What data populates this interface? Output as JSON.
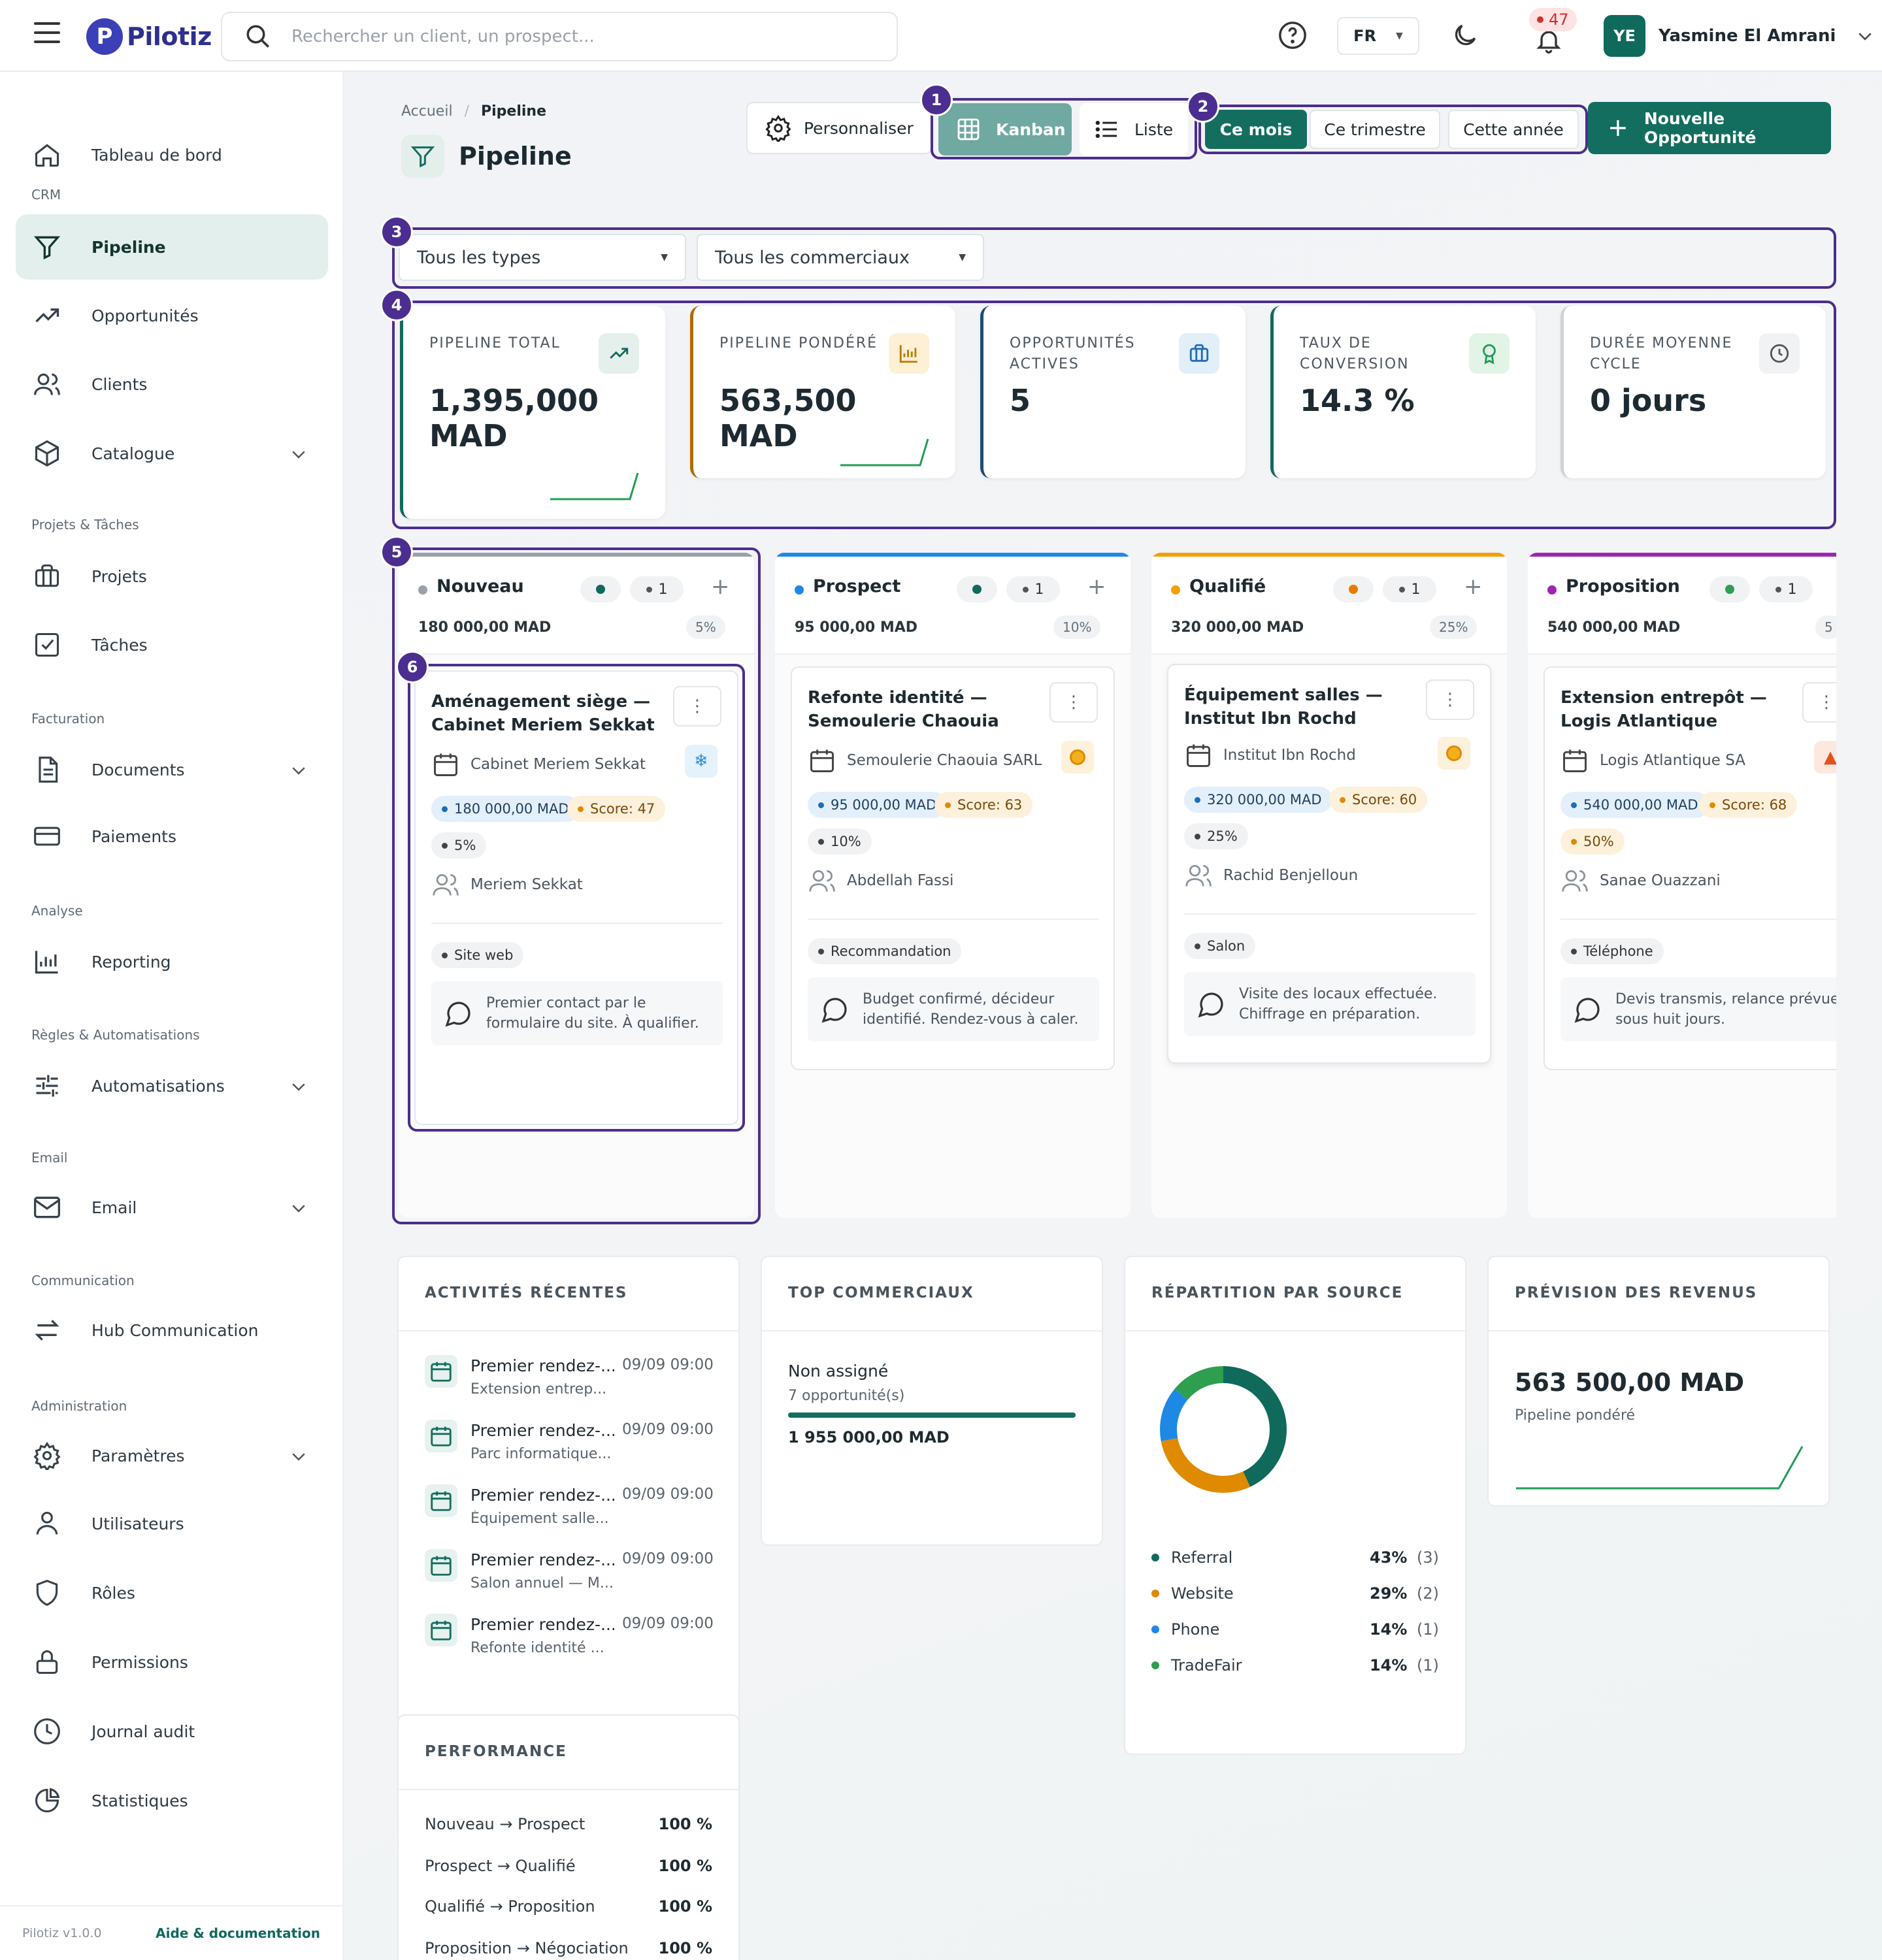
{
  "app": {
    "logo_letter": "P",
    "name": "Pilotiz"
  },
  "search": {
    "placeholder": "Rechercher un client, un prospect..."
  },
  "header": {
    "language": "FR",
    "notifications_count": "47",
    "user": {
      "initials": "YE",
      "name": "Yasmine El Amrani"
    }
  },
  "sidebar": {
    "items": [
      {
        "label": "Tableau de bord",
        "icon": "home-icon"
      },
      {
        "section": "CRM"
      },
      {
        "label": "Pipeline",
        "icon": "filter-icon",
        "active": true
      },
      {
        "label": "Opportunités",
        "icon": "trending-up-icon"
      },
      {
        "label": "Clients",
        "icon": "users-icon"
      },
      {
        "label": "Catalogue",
        "icon": "box-icon",
        "expandable": true
      },
      {
        "section": "Projets & Tâches"
      },
      {
        "label": "Projets",
        "icon": "briefcase-icon"
      },
      {
        "label": "Tâches",
        "icon": "checkbox-icon"
      },
      {
        "section": "Facturation"
      },
      {
        "label": "Documents",
        "icon": "document-icon",
        "expandable": true
      },
      {
        "label": "Paiements",
        "icon": "credit-card-icon"
      },
      {
        "section": "Analyse"
      },
      {
        "label": "Reporting",
        "icon": "bar-chart-icon"
      },
      {
        "section": "Règles & Automatisations"
      },
      {
        "label": "Automatisations",
        "icon": "sliders-icon",
        "expandable": true
      },
      {
        "section": "Email"
      },
      {
        "label": "Email",
        "icon": "mail-icon",
        "expandable": true
      },
      {
        "section": "Communication"
      },
      {
        "label": "Hub Communication",
        "icon": "arrows-icon"
      },
      {
        "section": "Administration"
      },
      {
        "label": "Paramètres",
        "icon": "gear-icon",
        "expandable": true
      },
      {
        "label": "Utilisateurs",
        "icon": "user-icon"
      },
      {
        "label": "Rôles",
        "icon": "shield-icon"
      },
      {
        "label": "Permissions",
        "icon": "lock-icon"
      },
      {
        "label": "Journal audit",
        "icon": "clock-icon"
      },
      {
        "label": "Statistiques",
        "icon": "pie-chart-icon"
      }
    ],
    "footer": {
      "version": "Pilotiz v1.0.0",
      "help": "Aide & documentation"
    }
  },
  "breadcrumb": {
    "home": "Accueil",
    "separator": "/",
    "current": "Pipeline"
  },
  "page": {
    "title": "Pipeline"
  },
  "toolbar": {
    "customize": "Personnaliser",
    "view_kanban": "Kanban",
    "view_list": "Liste",
    "period_month": "Ce mois",
    "period_quarter": "Ce trimestre",
    "period_year": "Cette année",
    "new_opportunity": "Nouvelle Opportunité"
  },
  "highlights": [
    "1",
    "2",
    "3",
    "4",
    "5",
    "6"
  ],
  "filters": {
    "types": "Tous les types",
    "sales": "Tous les commerciaux"
  },
  "kpis": [
    {
      "label": "PIPELINE TOTAL",
      "value": "1,395,000 MAD",
      "color": "#0f6a5c",
      "icon": "trend-up-icon"
    },
    {
      "label": "PIPELINE PONDÉRÉ",
      "value": "563,500 MAD",
      "color": "#b26a00",
      "icon": "bar-chart-icon"
    },
    {
      "label": "OPPORTUNITÉS ACTIVES",
      "value": "5",
      "color": "#1b4f72",
      "icon": "briefcase-icon"
    },
    {
      "label": "TAUX DE CONVERSION",
      "value": "14.3 %",
      "color": "#0f6a5c",
      "icon": "award-icon"
    },
    {
      "label": "DURÉE MOYENNE CYCLE",
      "value": "0 jours",
      "color": "#cfd3d8",
      "icon": "clock-icon"
    }
  ],
  "columns": [
    {
      "name": "Nouveau",
      "color": "#9aa1a8",
      "count": "1",
      "amount": "180 000,00 MAD",
      "probability": "5%",
      "card": {
        "title": "Aménagement siège — Cabinet Meriem Sekkat",
        "company": "Cabinet Meriem Sekkat",
        "temperature": "cold",
        "amount": "180 000,00 MAD",
        "score": "Score: 47",
        "probability": "5%",
        "owner": "Meriem Sekkat",
        "source": "Site web",
        "note": "Premier contact par le formulaire du site. À qualifier."
      }
    },
    {
      "name": "Prospect",
      "color": "#1e88e5",
      "count": "1",
      "amount": "95 000,00 MAD",
      "probability": "10%",
      "card": {
        "title": "Refonte identité — Semoulerie Chaouia",
        "company": "Semoulerie Chaouia SARL",
        "temperature": "warm",
        "amount": "95 000,00 MAD",
        "score": "Score: 63",
        "probability": "10%",
        "owner": "Abdellah Fassi",
        "source": "Recommandation",
        "note": "Budget confirmé, décideur identifié. Rendez-vous à caler."
      }
    },
    {
      "name": "Qualifié",
      "color": "#f59e0b",
      "count": "1",
      "amount": "320 000,00 MAD",
      "probability": "25%",
      "card": {
        "title": "Équipement salles — Institut Ibn Rochd",
        "company": "Institut Ibn Rochd",
        "temperature": "warm",
        "amount": "320 000,00 MAD",
        "score": "Score: 60",
        "probability": "25%",
        "owner": "Rachid Benjelloun",
        "source": "Salon",
        "note": "Visite des locaux effectuée. Chiffrage en préparation."
      }
    },
    {
      "name": "Proposition",
      "color": "#9c27b0",
      "count": "1",
      "amount": "540 000,00 MAD",
      "probability": "5",
      "card": {
        "title": "Extension entrepôt — Logis Atlantique",
        "company": "Logis Atlantique SA",
        "temperature": "hot",
        "amount": "540 000,00 MAD",
        "score": "Score: 68",
        "probability": "50%",
        "owner": "Sanae Ouazzani",
        "source": "Téléphone",
        "note": "Devis transmis, relance prévue sous huit jours."
      }
    }
  ],
  "activities": {
    "title": "ACTIVITÉS RÉCENTES",
    "items": [
      {
        "title": "Premier rendez-...",
        "time": "09/09 09:00",
        "sub": "Extension entrep..."
      },
      {
        "title": "Premier rendez-...",
        "time": "09/09 09:00",
        "sub": "Parc informatique..."
      },
      {
        "title": "Premier rendez-...",
        "time": "09/09 09:00",
        "sub": "Équipement salle..."
      },
      {
        "title": "Premier rendez-...",
        "time": "09/09 09:00",
        "sub": "Salon annuel — M..."
      },
      {
        "title": "Premier rendez-...",
        "time": "09/09 09:00",
        "sub": "Refonte identité ..."
      }
    ]
  },
  "top_sales": {
    "title": "TOP COMMERCIAUX",
    "name": "Non assigné",
    "count": "7 opportunité(s)",
    "amount": "1 955 000,00 MAD",
    "bar_fraction": 1.0
  },
  "sources": {
    "title": "RÉPARTITION PAR SOURCE",
    "items": [
      {
        "name": "Referral",
        "pct": "43%",
        "count": "(3)",
        "value": 43,
        "color": "#0f6a5c"
      },
      {
        "name": "Website",
        "pct": "29%",
        "count": "(2)",
        "value": 29,
        "color": "#e08a00"
      },
      {
        "name": "Phone",
        "pct": "14%",
        "count": "(1)",
        "value": 14,
        "color": "#1e88e5"
      },
      {
        "name": "TradeFair",
        "pct": "14%",
        "count": "(1)",
        "value": 14,
        "color": "#2e9e4f"
      }
    ]
  },
  "forecast": {
    "title": "PRÉVISION DES REVENUS",
    "value": "563 500,00 MAD",
    "label": "Pipeline pondéré"
  },
  "performance": {
    "title": "PERFORMANCE",
    "items": [
      {
        "name": "Nouveau → Prospect",
        "value": "100 %"
      },
      {
        "name": "Prospect → Qualifié",
        "value": "100 %"
      },
      {
        "name": "Qualifié → Proposition",
        "value": "100 %"
      },
      {
        "name": "Proposition → Négociation",
        "value": "100 %"
      }
    ]
  }
}
